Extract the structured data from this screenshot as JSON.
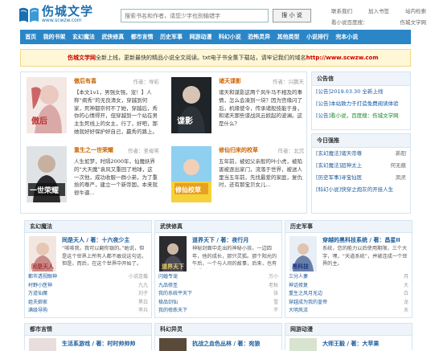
{
  "site": {
    "name": "伤城文学",
    "url": "www.scwzw.com"
  },
  "search": {
    "placeholder": "搜索书名和作者，请您少字也别输错字",
    "button": "搜 小 说"
  },
  "top_links": [
    [
      "联系我们",
      "加入书签",
      "站内检索"
    ],
    [
      "看小说百度搜：",
      "伤城文学网"
    ]
  ],
  "nav": [
    "首页",
    "我的书架",
    "玄幻魔法",
    "武侠修真",
    "都市言情",
    "历史军事",
    "网游动漫",
    "科幻小说",
    "恐怖灵异",
    "其他类型",
    "小说排行",
    "完本小说"
  ],
  "notice": {
    "brand": "伤城文学网",
    "text": "全新上线，更新最快的精品小说全文阅读。txt电子书全集下载站，请牢记我们的域名",
    "link": "http://www.scwzw.com"
  },
  "featured": [
    {
      "title": "傲后有喜",
      "author": "作者：导彩",
      "desc": "【本文1v1，男强女强，宠！】人称“病秀”的无良清女，穿越到何家，死神都奈何不了她，穿越后，秀你的心情得开，但穿越到一个站在男主生死线上的女主，行了，好吧，那她就好好保护好自己，赢秀的路上。"
    },
    {
      "title": "诸天谍影",
      "author": "作者：兴鹏天",
      "desc": "诸天和谋影这两个风牛马不相及的事情，怎么会凑到一块？因为宫缘闪了后，机缘使令，传承诸般技能于身，和诸天那些谍战风云掀起的波澜。这是什么？"
    },
    {
      "title": "重生之一世荣耀",
      "author": "作者：圣母笑",
      "desc": "人生如梦，时隔2000年，仙魔妖界的“大天魔”袁风又重回了地球，这一次他，成功收服一群小弟，为了重拾的尊严，建立一个新帝国，本来就很牛逼..."
    },
    {
      "title": "修仙归来的校草",
      "author": "作者：北沉",
      "desc": "五年前，被如父亲般的叶小虎，被陷害被逐出家门，流落于世界，被送人里当五年前，先找最爱的家庭，复仇时，还有那宝贝女儿..."
    }
  ],
  "announce": {
    "header": "公告信",
    "items": [
      {
        "tag": "[公告]",
        "text": "2019.03.30 全新上线",
        "date": ""
      },
      {
        "tag": "[公告]",
        "text": "本站致力于打造免费阅读体验",
        "date": ""
      },
      {
        "tag": "[公告]",
        "text": "看小说，百度搜：伤城文学网",
        "date": ""
      }
    ]
  },
  "ranking": {
    "header": "今日强推",
    "items": [
      {
        "t": "[玄幻魔法]诸天帝尊",
        "a": "新阳"
      },
      {
        "t": "[玄幻魔法]超神太上",
        "a": "何无痕"
      },
      {
        "t": "[历史军事]寻宝仙医",
        "a": "凤灵"
      },
      {
        "t": "[科幻小说]快穿之炮灰的开挂人生",
        "a": ""
      }
    ]
  },
  "categories": [
    {
      "header": "玄幻魔法",
      "top_title": "同是天人 / 著：十六夜少主",
      "top_desc": "“咳咳我，我可以翻你银的。”她说，但是这个世界上所有人都不敢说这句话，但是。而后，在这个世界中开始了。",
      "items": [
        [
          "都市透视眼神",
          "小说连载"
        ],
        [
          "村野小医神",
          "九九"
        ],
        [
          "万道仙魔",
          "刘子"
        ],
        [
          "姐夫娘家",
          "黑白"
        ],
        [
          "满级导购",
          "李兵"
        ],
        [
          "冷吴都市",
          "狂风"
        ],
        [
          "寒门首辅",
          "小小"
        ],
        [
          "诸天尊者",
          "东方"
        ],
        [
          "重生之星际",
          "青"
        ],
        [
          "我的重生",
          "小兵"
        ]
      ]
    },
    {
      "header": "武侠修真",
      "top_title": "道界天下 / 著：夜行月",
      "top_desc": "神秘封面中走出的神秘小孩，一边四年，他的成长，那只灵狐。那个阳光的午后，一个与人间的故事，后来，也有些爱到...",
      "items": [
        [
          "闪婚专宠",
          "万小"
        ],
        [
          "九品修圣",
          "老秋"
        ],
        [
          "我的系统平天下",
          "张"
        ],
        [
          "极品剑仙",
          "雪"
        ],
        [
          "我的修炼天下",
          "不"
        ],
        [
          "极品金刚",
          "紫"
        ],
        [
          "我的修行之路",
          "张"
        ],
        [
          "纯阳天主",
          "林"
        ],
        [
          "暗帝",
          "李"
        ],
        [
          "重生之仙",
          "大"
        ]
      ]
    },
    {
      "header": "历史军事",
      "top_title": "穿越的黑科技系统 / 著：昌星II",
      "top_desc": "系统，您的能力以后使用期限，三个大字，嘿，“天道系统”，并被连成一个世界的主。",
      "items": [
        [
          "三分人妻",
          "月"
        ],
        [
          "神话修复",
          "大"
        ],
        [
          "重生之风月无边",
          "白"
        ],
        [
          "穿越成为我的皇帝",
          "龙"
        ],
        [
          "大明风流",
          "天"
        ],
        [
          "影视之世界",
          "小"
        ],
        [
          "无上神帝",
          "山"
        ],
        [
          "寻宝全能王",
          "行"
        ],
        [
          "我的宝贝子",
          "易"
        ],
        [
          "天人们的",
          "山"
        ]
      ]
    }
  ],
  "bottom_cats": [
    {
      "header": "都市言情",
      "title": "生活系游戏 / 著：时时帅帅帅"
    },
    {
      "header": "科幻异灵",
      "title": "抗战之血色丛林 / 著：宛狼"
    },
    {
      "header": "网游动漫",
      "title": "大师王毅 / 著：大苹果"
    }
  ]
}
